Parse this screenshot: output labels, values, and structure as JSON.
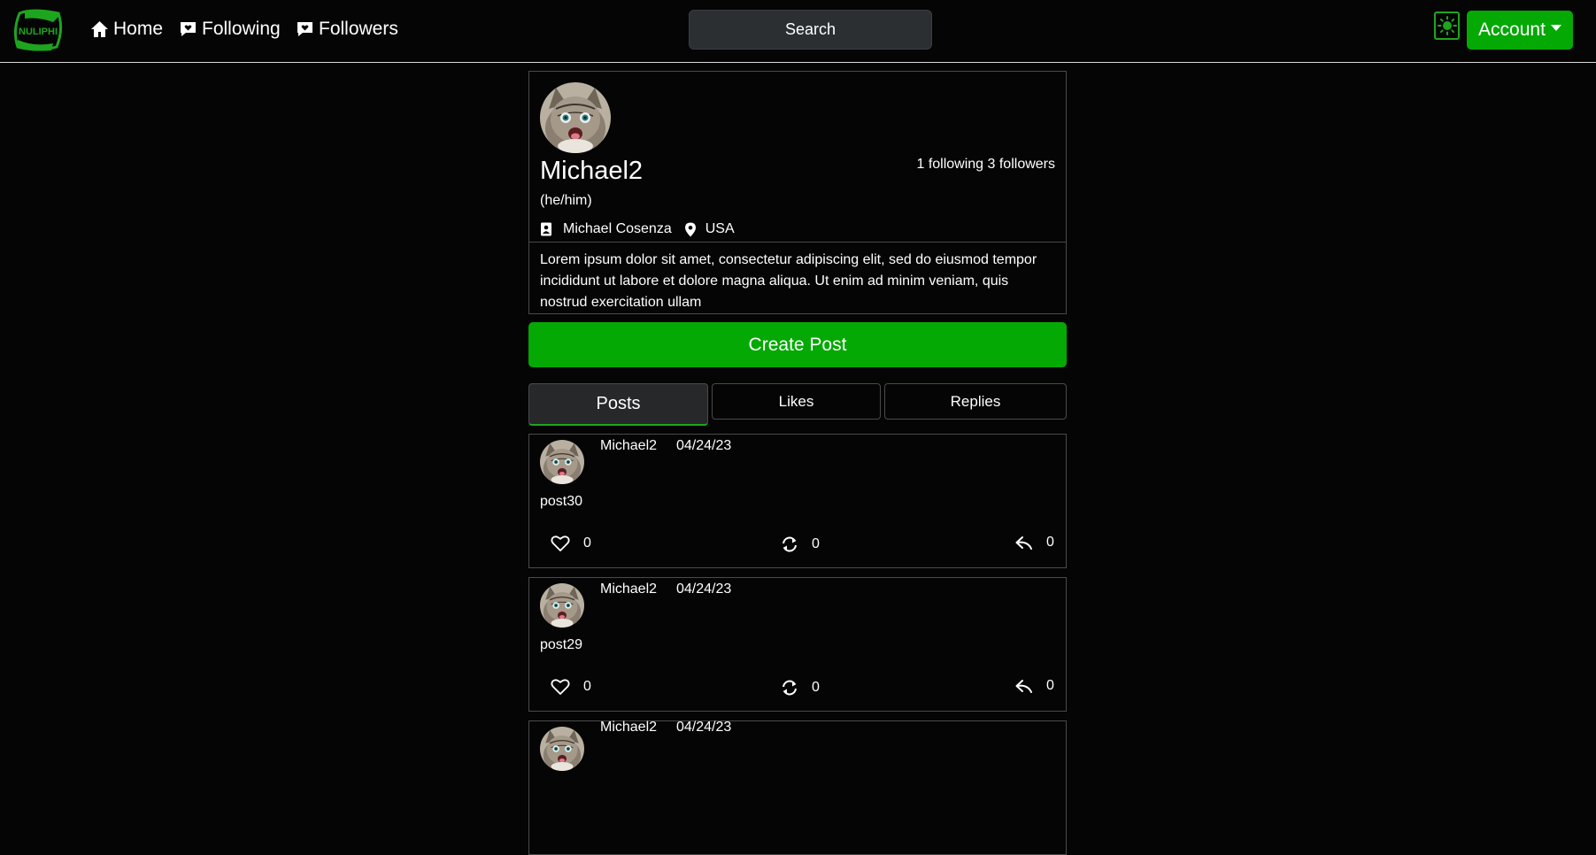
{
  "brand": {
    "name": "NULIPHI",
    "accent": "#04a904",
    "border": "#4a4a4a"
  },
  "nav": {
    "home": "Home",
    "following": "Following",
    "followers": "Followers",
    "search": "Search",
    "account": "Account"
  },
  "profile": {
    "username": "Michael2",
    "follow_counts": "1 following 3 followers",
    "pronouns": "(he/him)",
    "full_name": "Michael Cosenza",
    "location": "USA",
    "bio": "Lorem ipsum dolor sit amet, consectetur adipiscing elit, sed do eiusmod tempor incididunt ut labore et dolore magna aliqua. Ut enim ad minim veniam, quis nostrud exercitation ullam"
  },
  "create_post": "Create Post",
  "tabs": [
    "Posts",
    "Likes",
    "Replies"
  ],
  "posts": [
    {
      "author": "Michael2",
      "date": "04/24/23",
      "body": "post30",
      "likes": "0",
      "reposts": "0",
      "replies": "0"
    },
    {
      "author": "Michael2",
      "date": "04/24/23",
      "body": "post29",
      "likes": "0",
      "reposts": "0",
      "replies": "0"
    },
    {
      "author": "Michael2",
      "date": "04/24/23",
      "body": "",
      "likes": "",
      "reposts": "",
      "replies": ""
    }
  ]
}
